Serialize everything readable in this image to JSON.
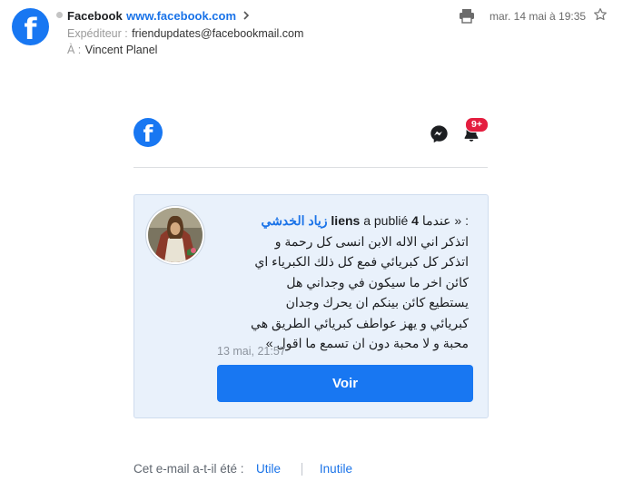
{
  "header": {
    "sender_name": "Facebook",
    "sender_link": "www.facebook.com",
    "from_label": "Expéditeur :",
    "from_value": "friendupdates@facebookmail.com",
    "to_label": "À :",
    "to_value": "Vincent Planel",
    "date": "mar. 14 mai à 19:35"
  },
  "email": {
    "notification_badge": "9+",
    "post": {
      "author": "زياد الخدشي",
      "published_prefix": "a publié",
      "published_count": "4 liens",
      "colon_quote": ": « عندما",
      "lines": [
        "اتذكر اني الاله الابن انسى كل رحمة و",
        "اتذكر كل كبريائي فمع كل ذلك الكبرياء اي",
        "كائن اخر ما سيكون في وجداني هل",
        "يستطيع كائن بينكم ان يحرك وجدان",
        "كبريائي و يهز عواطف كبريائي الطريق هي",
        "محبة و لا محبة دون ان تسمع ما اقول »"
      ],
      "timestamp": "13 mai, 21:57",
      "button_label": "Voir"
    },
    "footer": {
      "question": "Cet e-mail a-t-il été :",
      "useful": "Utile",
      "useless": "Inutile"
    }
  },
  "colors": {
    "facebook_blue": "#1877f2",
    "badge_red": "#e41e3f",
    "card_bg": "#e9f1fb"
  },
  "icons": [
    "facebook-logo-icon",
    "chevron-right-icon",
    "printer-icon",
    "star-icon",
    "messenger-icon",
    "bell-icon"
  ]
}
